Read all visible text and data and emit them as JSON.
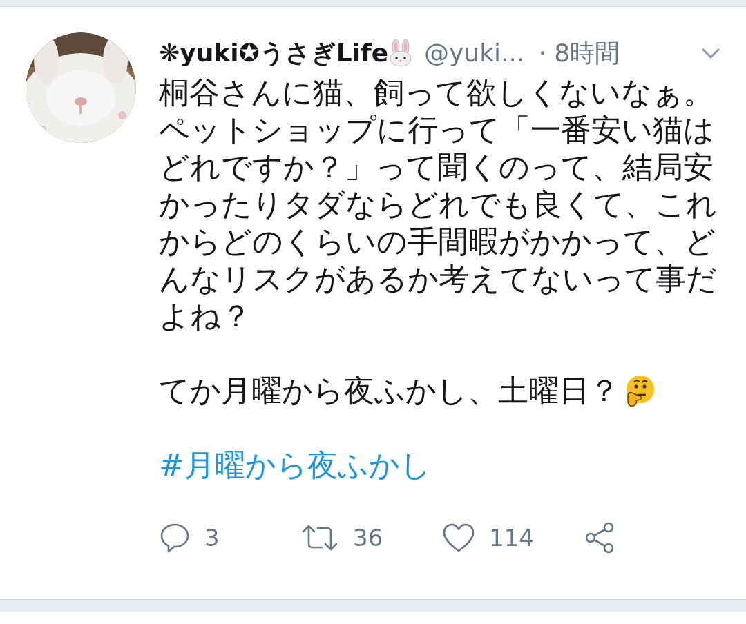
{
  "tweet": {
    "name": "❋yuki✪うさぎLife",
    "handle": "@yuki...",
    "time": "· 8時間",
    "paragraphs": [
      {
        "kind": "text",
        "text": "桐谷さんに猫、飼って欲しくないなぁ。ペットショップに行って「一番安い猫はどれですか？」って聞くのって、結局安かったりタダならどれでも良くて、これからどのくらいの手間暇がかかって、どんなリスクがあるか考えてないって事だよね？"
      },
      {
        "kind": "text_emoji",
        "text": "てか月曜から夜ふかし、土曜日？"
      },
      {
        "kind": "hashtag",
        "text": "#月曜から夜ふかし"
      }
    ],
    "actions": [
      {
        "kind": "reply",
        "count": "3"
      },
      {
        "kind": "retweet",
        "count": "36"
      },
      {
        "kind": "like",
        "count": "114"
      },
      {
        "kind": "share"
      }
    ]
  }
}
